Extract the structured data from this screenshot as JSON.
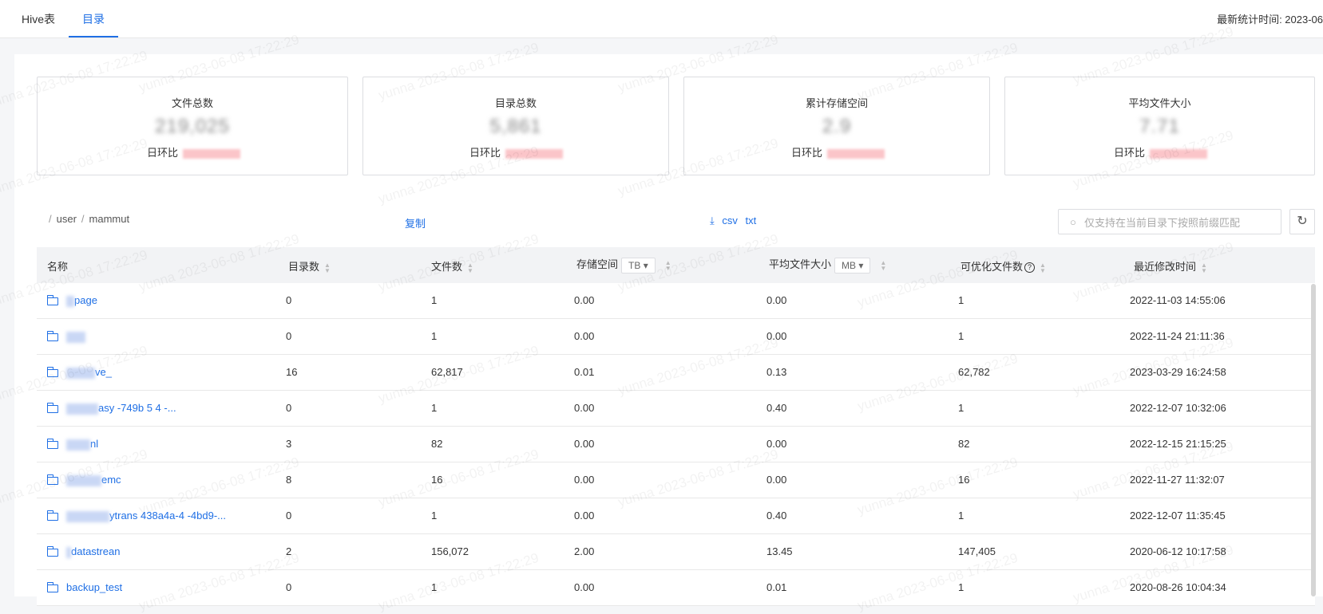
{
  "tabs": [
    {
      "label": "Hive表",
      "active": false
    },
    {
      "label": "目录",
      "active": true
    }
  ],
  "stat_time": "最新统计时间: 2023-06",
  "cards": [
    {
      "title": "文件总数",
      "value": "219,025",
      "ratio_label": "日环比"
    },
    {
      "title": "目录总数",
      "value": "5,861",
      "ratio_label": "日环比"
    },
    {
      "title": "累计存储空间",
      "value": "2.9",
      "ratio_label": "日环比"
    },
    {
      "title": "平均文件大小",
      "value": "7.71",
      "ratio_label": "日环比"
    }
  ],
  "breadcrumb": [
    "user",
    "mammut"
  ],
  "toolbar": {
    "copy_label": "复制",
    "csv_label": "csv",
    "txt_label": "txt",
    "search_placeholder": "仅支持在当前目录下按照前缀匹配"
  },
  "table": {
    "headers": {
      "name": "名称",
      "dir_count": "目录数",
      "file_count": "文件数",
      "storage": "存储空间",
      "storage_unit": "TB",
      "avg_size": "平均文件大小",
      "avg_unit": "MB",
      "optimizable": "可优化文件数",
      "modified": "最近修改时间"
    },
    "rows": [
      {
        "name": "page",
        "dirs": "0",
        "files": "1",
        "storage": "0.00",
        "avg": "0.00",
        "opt": "1",
        "time": "2022-11-03 14:55:06"
      },
      {
        "name": "",
        "dirs": "0",
        "files": "1",
        "storage": "0.00",
        "avg": "0.00",
        "opt": "1",
        "time": "2022-11-24 21:11:36"
      },
      {
        "name": "ve_",
        "dirs": "16",
        "files": "62,817",
        "storage": "0.01",
        "avg": "0.13",
        "opt": "62,782",
        "time": "2023-03-29 16:24:58"
      },
      {
        "name": "asy -749b 5 4 -...",
        "dirs": "0",
        "files": "1",
        "storage": "0.00",
        "avg": "0.40",
        "opt": "1",
        "time": "2022-12-07 10:32:06"
      },
      {
        "name": "nl",
        "dirs": "3",
        "files": "82",
        "storage": "0.00",
        "avg": "0.00",
        "opt": "82",
        "time": "2022-12-15 21:15:25"
      },
      {
        "name": "emc",
        "dirs": "8",
        "files": "16",
        "storage": "0.00",
        "avg": "0.00",
        "opt": "16",
        "time": "2022-11-27 11:32:07"
      },
      {
        "name": "ytrans 438a4a-4 -4bd9-...",
        "dirs": "0",
        "files": "1",
        "storage": "0.00",
        "avg": "0.40",
        "opt": "1",
        "time": "2022-12-07 11:35:45"
      },
      {
        "name": "datastrean",
        "dirs": "2",
        "files": "156,072",
        "storage": "2.00",
        "avg": "13.45",
        "opt": "147,405",
        "time": "2020-06-12 10:17:58"
      },
      {
        "name": "backup_test",
        "dirs": "0",
        "files": "1",
        "storage": "0.00",
        "avg": "0.01",
        "opt": "1",
        "time": "2020-08-26 10:04:34"
      }
    ]
  },
  "watermark": "yunna 2023-06-08 17:22:29"
}
